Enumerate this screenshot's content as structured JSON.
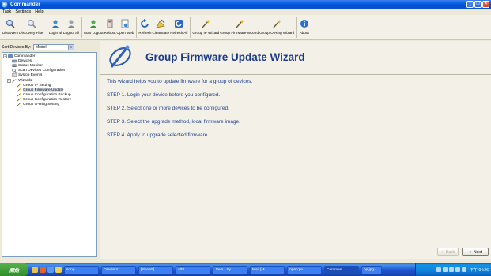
{
  "window": {
    "title": "Commander"
  },
  "menu": [
    "Task",
    "Settings",
    "Help"
  ],
  "toolbar": [
    {
      "label": "Discovery",
      "icon": "magnifier-icon"
    },
    {
      "label": "Discovery Filter",
      "icon": "filter-magnifier-icon"
    },
    {
      "label": "Login all",
      "icon": "user-icon"
    },
    {
      "label": "Logout all",
      "icon": "user-gray-icon"
    },
    {
      "label": "Auto Logout",
      "icon": "user-green-icon"
    },
    {
      "label": "Reboot",
      "icon": "reboot-icon"
    },
    {
      "label": "Open Web",
      "icon": "web-page-icon"
    },
    {
      "label": "Refresh",
      "icon": "refresh-icon"
    },
    {
      "label": "ClearState",
      "icon": "clear-state-icon"
    },
    {
      "label": "Refresh All",
      "icon": "refresh-all-icon"
    },
    {
      "label": "Group IP Wizard",
      "icon": "wand-icon"
    },
    {
      "label": "Group Firmware Wizard",
      "icon": "wand-icon"
    },
    {
      "label": "Group O-Ring Wizard",
      "icon": "wand-icon"
    },
    {
      "label": "About",
      "icon": "info-icon"
    }
  ],
  "sort": {
    "label": "Sort Devices By:",
    "value": "Model"
  },
  "tree": [
    {
      "label": "Commander",
      "level": 0,
      "expander": "−",
      "icon": "commander-icon"
    },
    {
      "label": "Devices",
      "level": 1,
      "icon": "devices-icon"
    },
    {
      "label": "Status Monitor",
      "level": 1,
      "icon": "monitor-icon"
    },
    {
      "label": "Scan Devices Configuration",
      "level": 1,
      "icon": "scan-icon"
    },
    {
      "label": "Syslog Events",
      "level": 1,
      "icon": "syslog-icon"
    },
    {
      "label": "Wizards",
      "level": 1,
      "expander": "−",
      "icon": "wizard-icon"
    },
    {
      "label": "Group IP Setting",
      "level": 2,
      "icon": "wand-icon"
    },
    {
      "label": "Group Firmware Update",
      "level": 2,
      "icon": "wand-icon",
      "selected": true
    },
    {
      "label": "Group Configuration Backup",
      "level": 2,
      "icon": "wand-icon"
    },
    {
      "label": "Group Configuration Restore",
      "level": 2,
      "icon": "wand-icon"
    },
    {
      "label": "Group O-Ring Setting",
      "level": 2,
      "icon": "wand-icon"
    }
  ],
  "wizard": {
    "title": "Group Firmware Update Wizard",
    "intro": "This wizard helps you to update firmware for a group of devices.",
    "steps": [
      "STEP 1. Login your device before you configured.",
      "STEP 2. Select one or more devices to be configured.",
      "STEP 3. Select the upgrade method, local firmware image.",
      "STEP 4. Apply to upgrade selected firmware"
    ],
    "back_label": "Back",
    "next_label": "Next"
  },
  "taskbar": {
    "start_label": "開始",
    "tasks": [
      "song",
      "Oracle Y...",
      "[Sheet*]",
      "att8",
      "Java - Sy...",
      "Mail [M...",
      "open:pu...",
      "Comman...",
      "op.jpg -"
    ],
    "active_task": 7,
    "clock": "下午 04:26"
  }
}
